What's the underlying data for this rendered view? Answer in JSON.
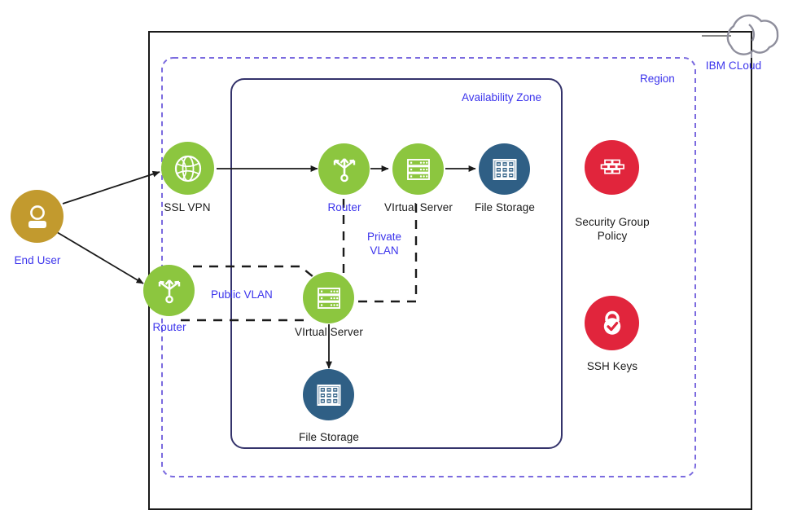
{
  "diagram": {
    "title": "IBM Cloud infrastructure architecture diagram",
    "colors": {
      "green": "#8CC63F",
      "storage_blue": "#2F5F85",
      "gold": "#C29A2E",
      "red": "#E1253C",
      "accent_text": "#3b33ec",
      "zone_border": "#34336b",
      "region_border": "#7b6bdf",
      "outer_border": "#1a1a1a",
      "connector": "#1a1a1a"
    }
  },
  "containers": {
    "outer": {
      "label": "",
      "name": "ibm-cloud-boundary"
    },
    "region": {
      "label": "Region"
    },
    "availability_zone": {
      "label": "Availability Zone"
    }
  },
  "cloud": {
    "label": "IBM CLoud",
    "icon": "cloud-icon"
  },
  "vlans": [
    {
      "id": "public-vlan",
      "label": "Public VLAN"
    },
    {
      "id": "private-vlan",
      "label": "Private\nVLAN",
      "line1": "Private",
      "line2": "VLAN"
    }
  ],
  "nodes": [
    {
      "id": "end-user",
      "label": "End User",
      "icon": "user-icon",
      "color": "#C29A2E",
      "label_color": "accent"
    },
    {
      "id": "ssl-vpn",
      "label": "SSL VPN",
      "icon": "globe-icon",
      "color": "#8CC63F",
      "label_color": "dark"
    },
    {
      "id": "router-public",
      "label": "Router",
      "icon": "router-icon",
      "color": "#8CC63F",
      "label_color": "accent"
    },
    {
      "id": "router-private",
      "label": "Router",
      "icon": "router-icon",
      "color": "#8CC63F",
      "label_color": "accent"
    },
    {
      "id": "virtual-server-top",
      "label": "VIrtual Server",
      "icon": "server-rack-icon",
      "color": "#8CC63F",
      "label_color": "dark"
    },
    {
      "id": "virtual-server-bottom",
      "label": "VIrtual Server",
      "icon": "server-rack-icon",
      "color": "#8CC63F",
      "label_color": "dark"
    },
    {
      "id": "file-storage-top",
      "label": "File Storage",
      "icon": "file-storage-icon",
      "color": "#2F5F85",
      "label_color": "dark"
    },
    {
      "id": "file-storage-bottom",
      "label": "File Storage",
      "icon": "file-storage-icon",
      "color": "#2F5F85",
      "label_color": "dark"
    },
    {
      "id": "security-group-policy",
      "label": "Security Group Policy",
      "line1": "Security Group",
      "line2": "Policy",
      "icon": "firewall-icon",
      "color": "#E1253C",
      "label_color": "dark"
    },
    {
      "id": "ssh-keys",
      "label": "SSH Keys",
      "icon": "lock-check-icon",
      "color": "#E1253C",
      "label_color": "dark"
    }
  ]
}
